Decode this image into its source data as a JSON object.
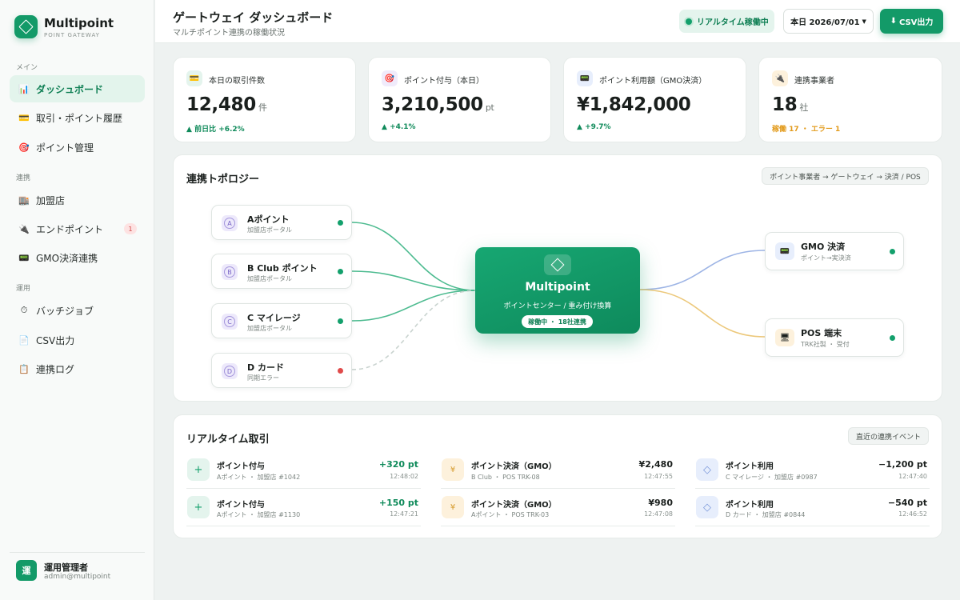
{
  "brand": {
    "name": "Multipoint",
    "sub": "POINT GATEWAY",
    "color": "#139a68"
  },
  "sidebar": {
    "sections": [
      "メイン",
      "連携",
      "運用"
    ],
    "items": [
      {
        "label": "ダッシュボード",
        "icon": "bar-chart-icon",
        "active": true
      },
      {
        "label": "取引・ポイント履歴",
        "icon": "card-icon"
      },
      {
        "label": "ポイント管理",
        "icon": "target-icon"
      },
      {
        "label": "加盟店",
        "icon": "building-icon"
      },
      {
        "label": "エンドポイント",
        "icon": "plug-icon",
        "badge": "1"
      },
      {
        "label": "GMO決済連携",
        "icon": "terminal-icon"
      },
      {
        "label": "バッチジョブ",
        "icon": "clock-icon"
      },
      {
        "label": "CSV出力",
        "icon": "file-icon"
      },
      {
        "label": "連携ログ",
        "icon": "log-icon"
      }
    ]
  },
  "user": {
    "avatar": "運",
    "name": "運用管理者",
    "email": "admin@multipoint"
  },
  "header": {
    "title": "ゲートウェイ ダッシュボード",
    "subtitle": "マルチポイント連携の稼働状況",
    "status": "リアルタイム稼働中",
    "date": "本日 2026/07/01",
    "csv_button": "CSV出力"
  },
  "kpis": [
    {
      "label": "本日の取引件数",
      "value": "12,480",
      "unit": "件",
      "delta": "前日比 +6.2%",
      "icon": "card-icon"
    },
    {
      "label": "ポイント付与（本日）",
      "value": "3,210,500",
      "unit": "pt",
      "delta": "+4.1%",
      "icon": "target-icon"
    },
    {
      "label": "ポイント利用額（GMO決済）",
      "value": "¥1,842,000",
      "unit": "",
      "delta": "+9.7%",
      "icon": "terminal-icon"
    },
    {
      "label": "連携事業者",
      "value": "18",
      "unit": "社",
      "delta": "稼働 17 ・ エラー 1",
      "icon": "plug-icon"
    }
  ],
  "topology": {
    "title": "連携トポロジー",
    "flow": "ポイント事業者 → ゲートウェイ → 決済 / POS",
    "sources": [
      {
        "badge": "A",
        "name": "Aポイント",
        "sub": "加盟店ポータル",
        "status": "ok"
      },
      {
        "badge": "B",
        "name": "B Club ポイント",
        "sub": "加盟店ポータル",
        "status": "ok"
      },
      {
        "badge": "C",
        "name": "C マイレージ",
        "sub": "加盟店ポータル",
        "status": "ok"
      },
      {
        "badge": "D",
        "name": "D カード",
        "sub": "同期エラー",
        "status": "error"
      }
    ],
    "hub": {
      "name": "Multipoint",
      "sub": "ポイントセンター / 重み付け換算",
      "pill": "稼働中 ・ 18社連携"
    },
    "destinations": [
      {
        "name": "GMO 決済",
        "sub": "ポイント→実決済",
        "icon": "terminal-icon"
      },
      {
        "name": "POS 端末",
        "sub": "TRK社製 ・ 受付",
        "icon": "pos-icon"
      }
    ]
  },
  "transactions": {
    "title": "リアルタイム取引",
    "pill": "直近の連携イベント",
    "columns": [
      [
        {
          "title": "ポイント付与",
          "sub": "Aポイント ・ 加盟店 #1042",
          "amount": "+320 pt",
          "time": "12:48:02"
        },
        {
          "title": "ポイント付与",
          "sub": "Aポイント ・ 加盟店 #1130",
          "amount": "+150 pt",
          "time": "12:47:21"
        }
      ],
      [
        {
          "title": "ポイント決済（GMO）",
          "sub": "B Club ・ POS TRK-08",
          "amount": "¥2,480",
          "time": "12:47:55"
        },
        {
          "title": "ポイント決済（GMO）",
          "sub": "Aポイント ・ POS TRK-03",
          "amount": "¥980",
          "time": "12:47:08"
        }
      ],
      [
        {
          "title": "ポイント利用",
          "sub": "C マイレージ ・ 加盟店 #0987",
          "amount": "−1,200 pt",
          "time": "12:47:40"
        },
        {
          "title": "ポイント利用",
          "sub": "D カード ・ 加盟店 #0844",
          "amount": "−540 pt",
          "time": "12:46:52"
        }
      ]
    ]
  }
}
